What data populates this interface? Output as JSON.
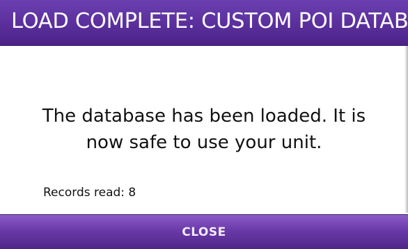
{
  "dialog": {
    "title": "LOAD COMPLETE: CUSTOM POI DATABASE",
    "message_line1": "The database has been loaded. It is",
    "message_line2": "now safe to use your unit.",
    "records_label": "Records read: 8"
  },
  "actions": {
    "close_label": "CLOSE"
  },
  "colors": {
    "title_bar": "#5a2f9c",
    "button": "#6a3aa8",
    "background": "#ffffff",
    "text": "#111111"
  }
}
